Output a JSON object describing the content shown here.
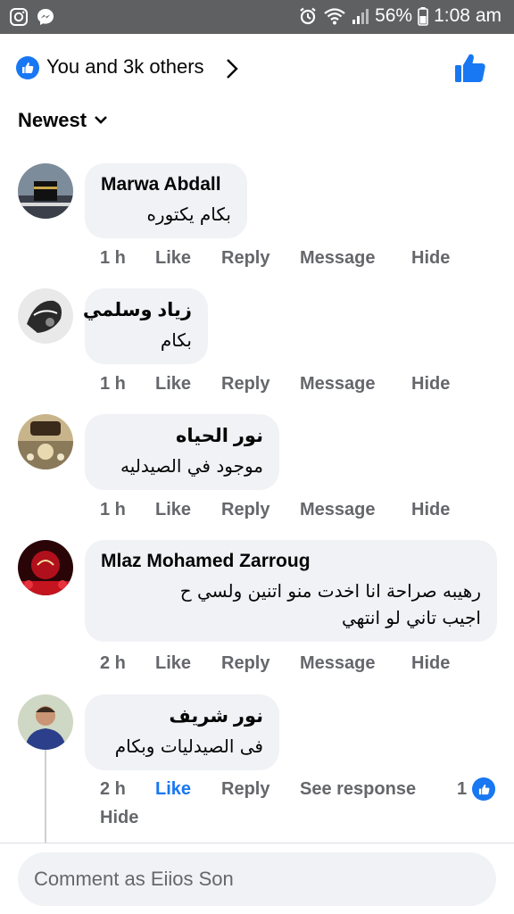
{
  "status_bar": {
    "battery": "56%",
    "time": "1:08 am",
    "icons": [
      "instagram-icon",
      "messenger-icon",
      "alarm-icon",
      "wifi-icon",
      "signal-icon",
      "battery-icon"
    ]
  },
  "reactions": {
    "summary": "You and 3k others"
  },
  "sort": {
    "label": "Newest"
  },
  "comments": [
    {
      "author": "Marwa Abdall",
      "text": "بكام يكتوره",
      "time": "1 h",
      "like": "Like",
      "reply": "Reply",
      "message": "Message",
      "hide": "Hide"
    },
    {
      "author": "زياد وسلمي",
      "text": "بكام",
      "time": "1 h",
      "like": "Like",
      "reply": "Reply",
      "message": "Message",
      "hide": "Hide"
    },
    {
      "author": "نور الحياه",
      "text": "موجود في الصيدليه",
      "time": "1 h",
      "like": "Like",
      "reply": "Reply",
      "message": "Message",
      "hide": "Hide"
    },
    {
      "author": "Mlaz Mohamed Zarroug",
      "text_line1": "رهيبه صراحة انا اخدت منو اتنين ولسي ح",
      "text_line2": "اجيب تاني لو انتهي",
      "time": "2 h",
      "like": "Like",
      "reply": "Reply",
      "message": "Message",
      "hide": "Hide"
    },
    {
      "author": "نور شريف",
      "text": "فى الصيدليات وبكام",
      "time": "2 h",
      "like": "Like",
      "reply": "Reply",
      "see_response": "See response",
      "like_count": "1",
      "hide": "Hide"
    }
  ],
  "footer": {
    "placeholder": "Comment as Eiios Son"
  },
  "colors": {
    "accent": "#1877f2",
    "bubble": "#f0f2f5",
    "secondary_text": "#65676b",
    "status_bar": "#5f6061"
  }
}
